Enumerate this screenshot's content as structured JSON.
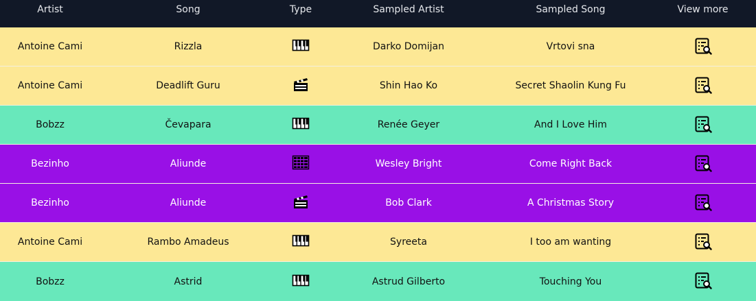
{
  "header": {
    "artist": "Artist",
    "song": "Song",
    "type": "Type",
    "sampled_artist": "Sampled Artist",
    "sampled_song": "Sampled Song",
    "view_more": "View more"
  },
  "colors": {
    "header_bg": "#111827",
    "yellow": "#FDE895",
    "green": "#68E8BB",
    "purple": "#9910E6"
  },
  "rows": [
    {
      "artist": "Antoine Cami",
      "song": "Rizzla",
      "type": "piano-icon",
      "sampled_artist": "Darko Domijan",
      "sampled_song": "Vrtovi sna",
      "color": "yellow"
    },
    {
      "artist": "Antoine Cami",
      "song": "Deadlift Guru",
      "type": "clapperboard-icon",
      "sampled_artist": "Shin Hao Ko",
      "sampled_song": "Secret Shaolin Kung Fu",
      "color": "yellow"
    },
    {
      "artist": "Bobzz",
      "song": "Čevapara",
      "type": "piano-icon",
      "sampled_artist": "Renée Geyer",
      "sampled_song": "And I Love Him",
      "color": "green"
    },
    {
      "artist": "Bezinho",
      "song": "Aliunde",
      "type": "drum-machine-icon",
      "sampled_artist": "Wesley Bright",
      "sampled_song": "Come Right Back",
      "color": "purple"
    },
    {
      "artist": "Bezinho",
      "song": "Aliunde",
      "type": "clapperboard-icon",
      "sampled_artist": "Bob Clark",
      "sampled_song": "A Christmas Story",
      "color": "purple"
    },
    {
      "artist": "Antoine Cami",
      "song": "Rambo Amadeus",
      "type": "piano-icon",
      "sampled_artist": "Syreeta",
      "sampled_song": "I too am wanting",
      "color": "yellow"
    },
    {
      "artist": "Bobzz",
      "song": "Astrid",
      "type": "piano-icon",
      "sampled_artist": "Astrud Gilberto",
      "sampled_song": "Touching You",
      "color": "green"
    }
  ]
}
